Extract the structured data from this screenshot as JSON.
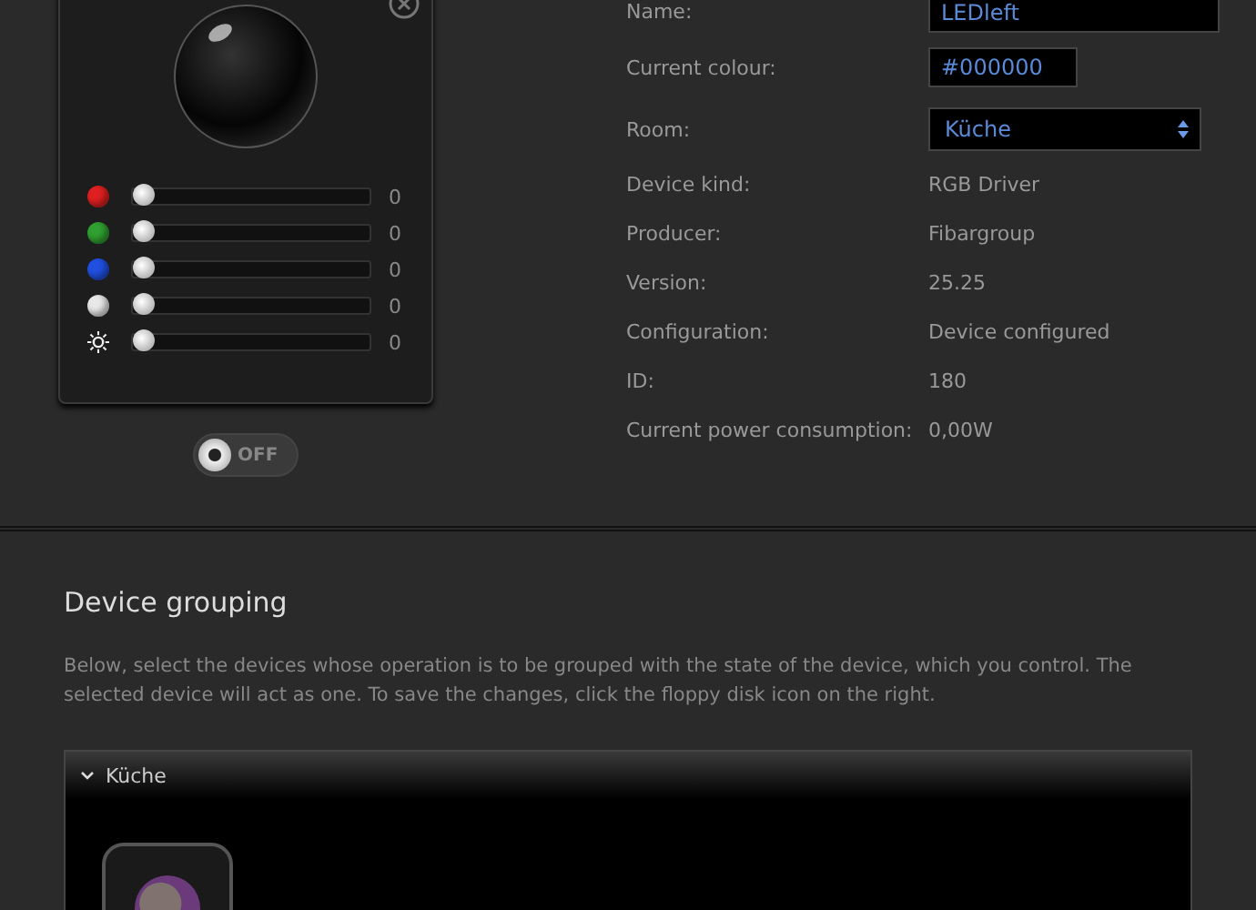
{
  "device_panel": {
    "channels": [
      {
        "kind": "color",
        "color": "#e02020",
        "level": 0,
        "value": "0"
      },
      {
        "kind": "color",
        "color": "#30a030",
        "level": 0,
        "value": "0"
      },
      {
        "kind": "color",
        "color": "#2050e0",
        "level": 0,
        "value": "0"
      },
      {
        "kind": "color",
        "color": "#e8e8e8",
        "level": 0,
        "value": "0"
      },
      {
        "kind": "brightness",
        "level": 0,
        "value": "0"
      }
    ]
  },
  "power_switch": {
    "label": "OFF",
    "on": false
  },
  "properties": [
    {
      "kind": "text-field",
      "label": "Name:",
      "value": "LEDleft"
    },
    {
      "kind": "color-field",
      "label": "Current colour:",
      "value": "#000000"
    },
    {
      "kind": "select",
      "label": "Room:",
      "value": "Küche"
    },
    {
      "kind": "text",
      "label": "Device kind:",
      "value": "RGB Driver"
    },
    {
      "kind": "text",
      "label": "Producer:",
      "value": "Fibargroup"
    },
    {
      "kind": "text",
      "label": "Version:",
      "value": "25.25"
    },
    {
      "kind": "text",
      "label": "Configuration:",
      "value": "Device configured"
    },
    {
      "kind": "text",
      "label": "ID:",
      "value": "180"
    },
    {
      "kind": "text",
      "label": "Current power consumption:",
      "value": "0,00W"
    }
  ],
  "grouping": {
    "title": "Device grouping",
    "description": "Below, select the devices whose operation is to be grouped with the state of the device, which you control. The selected device will act as one. To save the changes, click the floppy disk icon on the right.",
    "groups": [
      {
        "name": "Küche",
        "expanded": true
      }
    ]
  }
}
